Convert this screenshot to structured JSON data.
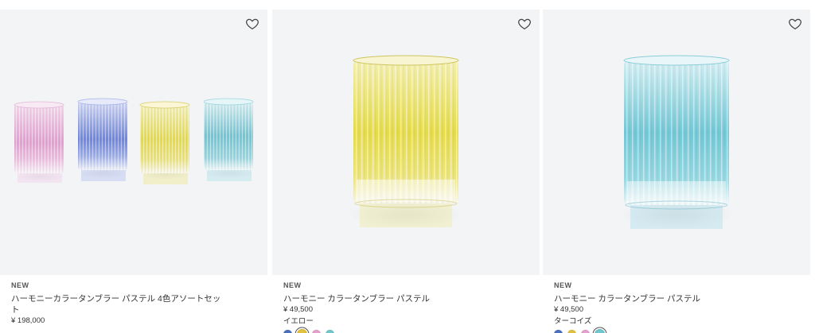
{
  "products": [
    {
      "badge": "NEW",
      "name": "ハーモニーカラータンブラー パステル 4色アソートセット",
      "price": "¥ 198,000",
      "image": "four-pastel-tumblers",
      "favorite_icon": "heart-outline-icon"
    },
    {
      "badge": "NEW",
      "name": "ハーモニー カラータンブラー パステル",
      "price": "¥ 49,500",
      "variant": "イエロー",
      "image": "yellow-tumbler",
      "favorite_icon": "heart-outline-icon",
      "swatches": [
        {
          "color": "#4a70c0",
          "selected": false
        },
        {
          "color": "#e2c23a",
          "selected": true
        },
        {
          "color": "#e8a0cf",
          "selected": false
        },
        {
          "color": "#6fc8cc",
          "selected": false
        }
      ]
    },
    {
      "badge": "NEW",
      "name": "ハーモニー カラータンブラー パステル",
      "price": "¥ 49,500",
      "variant": "ターコイズ",
      "image": "turquoise-tumbler",
      "favorite_icon": "heart-outline-icon",
      "swatches": [
        {
          "color": "#4a70c0",
          "selected": false
        },
        {
          "color": "#e2c23a",
          "selected": false
        },
        {
          "color": "#e8a0cf",
          "selected": false
        },
        {
          "color": "#6fc8cc",
          "selected": true
        }
      ]
    }
  ],
  "colors": {
    "pink": "#e6a6d6",
    "blue": "#7a8fe0",
    "yellow": "#e9e05a",
    "turquoise": "#7ed0dc",
    "image_bg": "#f2f4f6"
  }
}
